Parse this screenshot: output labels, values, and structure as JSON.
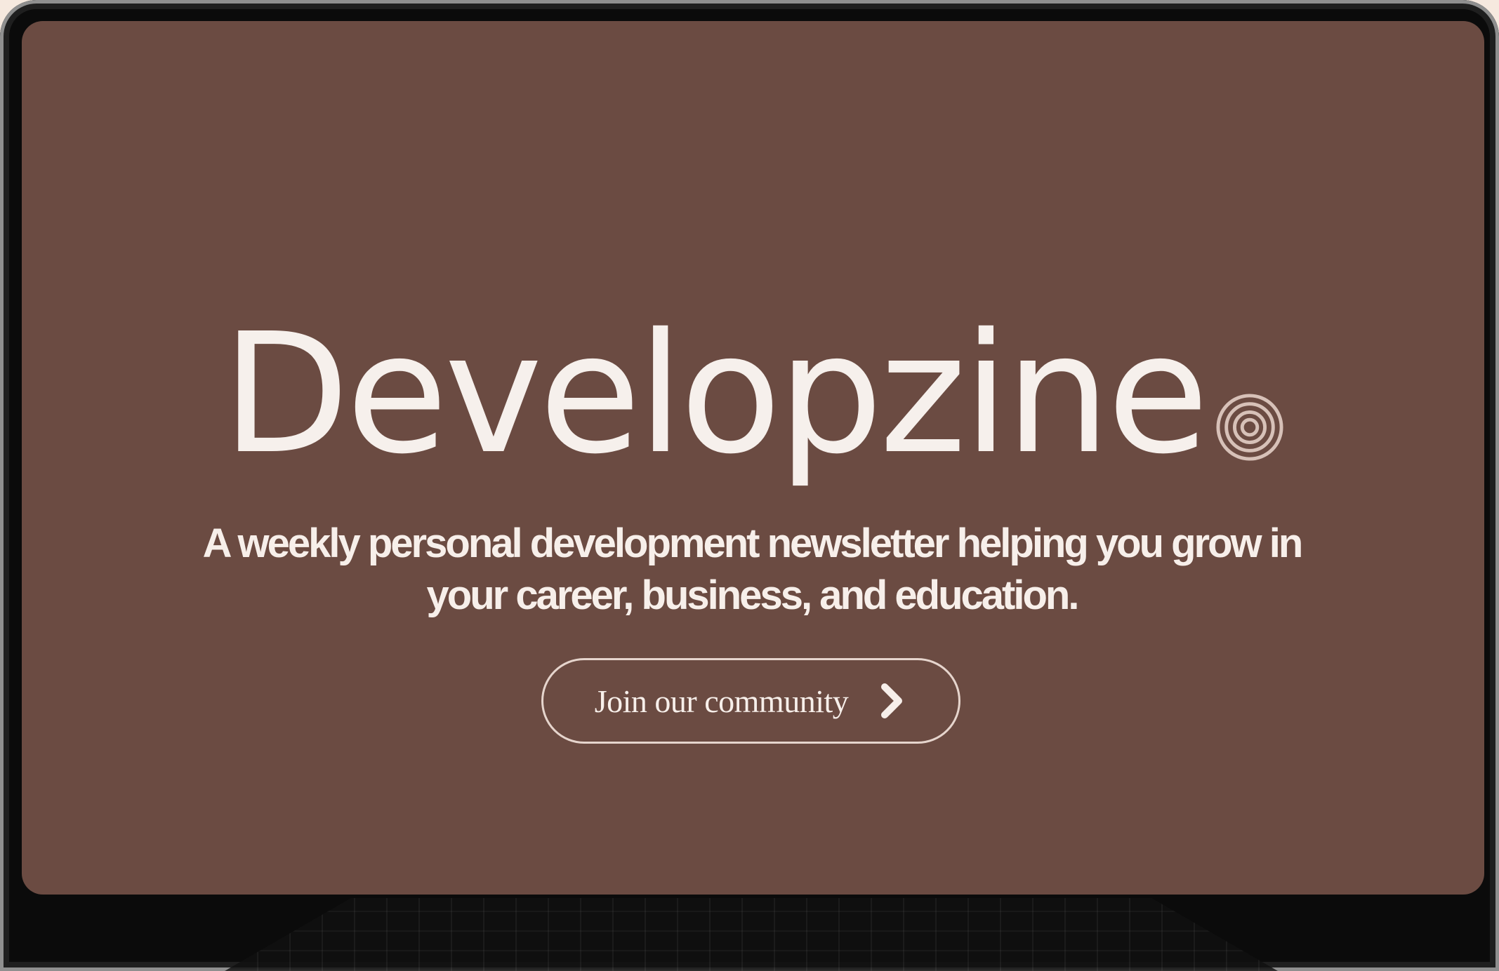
{
  "hero": {
    "brand_name": "Developzine",
    "brand_mark_icon": "concentric-circles-icon",
    "tagline_line1": "A weekly personal development newsletter helping you grow in",
    "tagline_line2": "your career, business, and education.",
    "cta_label": "Join our community",
    "cta_icon": "chevron-right-icon"
  },
  "colors": {
    "screen_background": "#6b4b42",
    "text": "#f7efea",
    "button_border": "#e6d5cd",
    "device_frame": "#0b0b0b",
    "page_background": "#f6e9df"
  }
}
